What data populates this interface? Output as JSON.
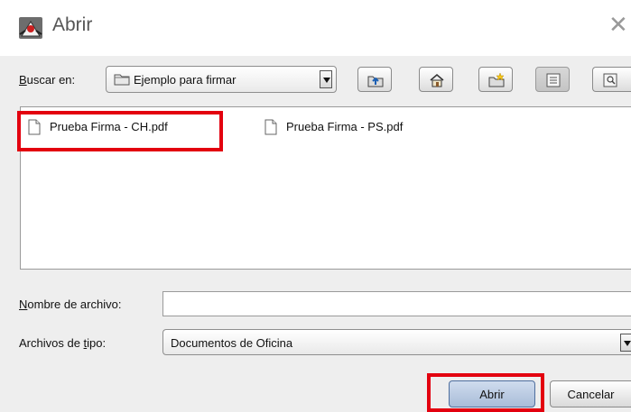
{
  "window": {
    "title": "Abrir",
    "close_glyph": "✕",
    "app_icon": "java-duke-icon"
  },
  "lookin": {
    "label_prefix": "",
    "label_mnemonic": "B",
    "label_rest": "uscar en:",
    "value": "Ejemplo para firmar"
  },
  "toolbar": {
    "buttons": [
      {
        "name": "up-one-level-button",
        "icon": "folder-up-icon"
      },
      {
        "name": "home-button",
        "icon": "home-icon"
      },
      {
        "name": "new-folder-button",
        "icon": "new-folder-icon"
      },
      {
        "name": "list-view-button",
        "icon": "list-view-icon",
        "pressed": true
      },
      {
        "name": "details-view-button",
        "icon": "details-view-icon"
      }
    ]
  },
  "files": [
    {
      "name": "Prueba Firma - CH.pdf",
      "icon": "document-icon",
      "highlighted": true
    },
    {
      "name": "Prueba Firma - PS.pdf",
      "icon": "document-icon",
      "highlighted": false
    }
  ],
  "filename": {
    "label_mnemonic": "N",
    "label_rest": "ombre de archivo:",
    "value": ""
  },
  "filetype": {
    "label_prefix": "Archivos de ",
    "label_mnemonic": "t",
    "label_rest": "ipo:",
    "value": "Documentos de Oficina"
  },
  "buttons": {
    "open": "Abrir",
    "cancel": "Cancelar"
  },
  "colors": {
    "highlight": "#e3000f",
    "panel_bg": "#eeeeee"
  }
}
